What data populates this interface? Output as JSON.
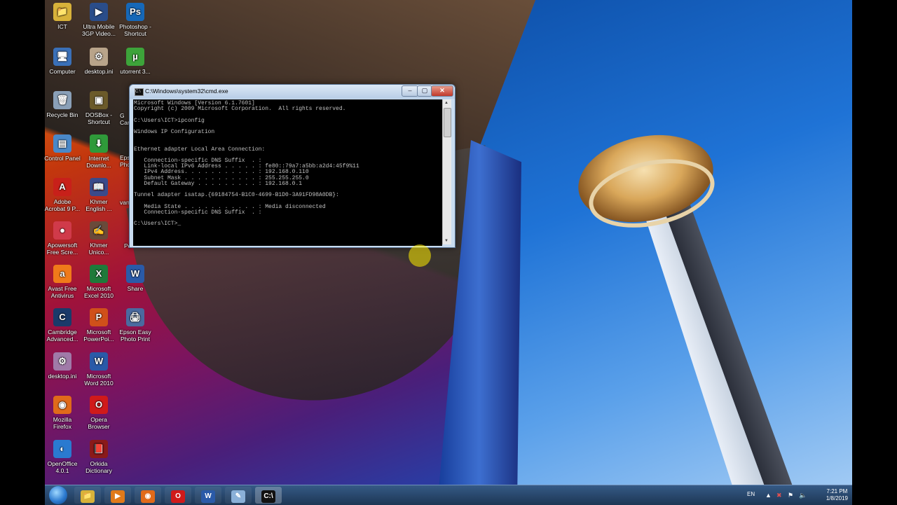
{
  "desktop": {
    "icons": [
      {
        "label": "ICT",
        "glyph": "📁",
        "color": "#d8b23a"
      },
      {
        "label": "Ultra Mobile 3GP Video...",
        "glyph": "▶",
        "color": "#2a4d8a"
      },
      {
        "label": "Photoshop - Shortcut",
        "glyph": "Ps",
        "color": "#1668b8"
      },
      {
        "label": "Computer",
        "glyph": "🖥",
        "color": "#3a70b8"
      },
      {
        "label": "desktop.ini",
        "glyph": "⚙",
        "color": "#b9a48a"
      },
      {
        "label": "utorrent 3...",
        "glyph": "µ",
        "color": "#3da33a"
      },
      {
        "label": "Recycle Bin",
        "glyph": "🗑",
        "color": "#8aa0b8"
      },
      {
        "label": "DOSBox - Shortcut",
        "glyph": "▣",
        "color": "#6b5a2a"
      },
      {
        "label": "Control Panel",
        "glyph": "▤",
        "color": "#4a88c8"
      },
      {
        "label": "Internet Downlo...",
        "glyph": "⬇",
        "color": "#2f9a3a"
      },
      {
        "label": "Adobe Acrobat 9 P...",
        "glyph": "A",
        "color": "#c8201a"
      },
      {
        "label": "Khmer English ...",
        "glyph": "📖",
        "color": "#3a4a8a"
      },
      {
        "label": "Apowersoft Free Scre...",
        "glyph": "●",
        "color": "#d03a4a"
      },
      {
        "label": "Khmer Unico...",
        "glyph": "✍",
        "color": "#6a4a3a"
      },
      {
        "label": "Avast Free Antivirus",
        "glyph": "a",
        "color": "#f07a1a"
      },
      {
        "label": "Microsoft Excel 2010",
        "glyph": "X",
        "color": "#1f7a3a"
      },
      {
        "label": "Share",
        "glyph": "W",
        "color": "#2a5aa8"
      },
      {
        "label": "Cambridge Advanced...",
        "glyph": "C",
        "color": "#1a3a6a"
      },
      {
        "label": "Microsoft PowerPoi...",
        "glyph": "P",
        "color": "#d0501a"
      },
      {
        "label": "Epson Easy Photo Print",
        "glyph": "🖨",
        "color": "#4a6aa0"
      },
      {
        "label": "desktop.ini",
        "glyph": "⚙",
        "color": "#a07aa8"
      },
      {
        "label": "Microsoft Word 2010",
        "glyph": "W",
        "color": "#2a5aa8"
      },
      {
        "label": "Mozilla Firefox",
        "glyph": "◉",
        "color": "#e06a1a"
      },
      {
        "label": "Opera Browser",
        "glyph": "O",
        "color": "#d01a1a"
      },
      {
        "label": "OpenOffice 4.0.1",
        "glyph": "◐",
        "color": "#2a7ad0"
      },
      {
        "label": "Orkida Dictionary",
        "glyph": "📕",
        "color": "#8a1a1a"
      }
    ],
    "partial_labels": [
      "Eps",
      "Pho",
      "G",
      "Can",
      "van",
      "Pc"
    ]
  },
  "cmd": {
    "title": "C:\\Windows\\system32\\cmd.exe",
    "icon_text": "C:\\",
    "minimize": "–",
    "maximize": "▢",
    "close": "✕",
    "lines": [
      "Microsoft Windows [Version 6.1.7601]",
      "Copyright (c) 2009 Microsoft Corporation.  All rights reserved.",
      "",
      "C:\\Users\\ICT>ipconfig",
      "",
      "Windows IP Configuration",
      "",
      "",
      "Ethernet adapter Local Area Connection:",
      "",
      "   Connection-specific DNS Suffix  . :",
      "   Link-local IPv6 Address . . . . . : fe80::79a7:a5bb:a2d4:45f9%11",
      "   IPv4 Address. . . . . . . . . . . : 192.168.0.110",
      "   Subnet Mask . . . . . . . . . . . : 255.255.255.0",
      "   Default Gateway . . . . . . . . . : 192.168.0.1",
      "",
      "Tunnel adapter isatap.{69184754-B1C0-4699-B1D0-3A91FD98A0DB}:",
      "",
      "   Media State . . . . . . . . . . . : Media disconnected",
      "   Connection-specific DNS Suffix  . :",
      "",
      "C:\\Users\\ICT>_"
    ]
  },
  "taskbar": {
    "apps": [
      {
        "name": "explorer",
        "glyph": "📁",
        "color": "#d8b23a"
      },
      {
        "name": "media-player",
        "glyph": "▶",
        "color": "#e07a1a"
      },
      {
        "name": "firefox",
        "glyph": "◉",
        "color": "#e06a1a"
      },
      {
        "name": "opera",
        "glyph": "O",
        "color": "#d01a1a"
      },
      {
        "name": "word",
        "glyph": "W",
        "color": "#2a5aa8"
      },
      {
        "name": "notepad",
        "glyph": "✎",
        "color": "#8ab0d8"
      },
      {
        "name": "cmd",
        "glyph": "C:\\",
        "color": "#111111"
      }
    ],
    "language": "EN",
    "time": "7:21 PM",
    "date": "1/8/2019"
  }
}
